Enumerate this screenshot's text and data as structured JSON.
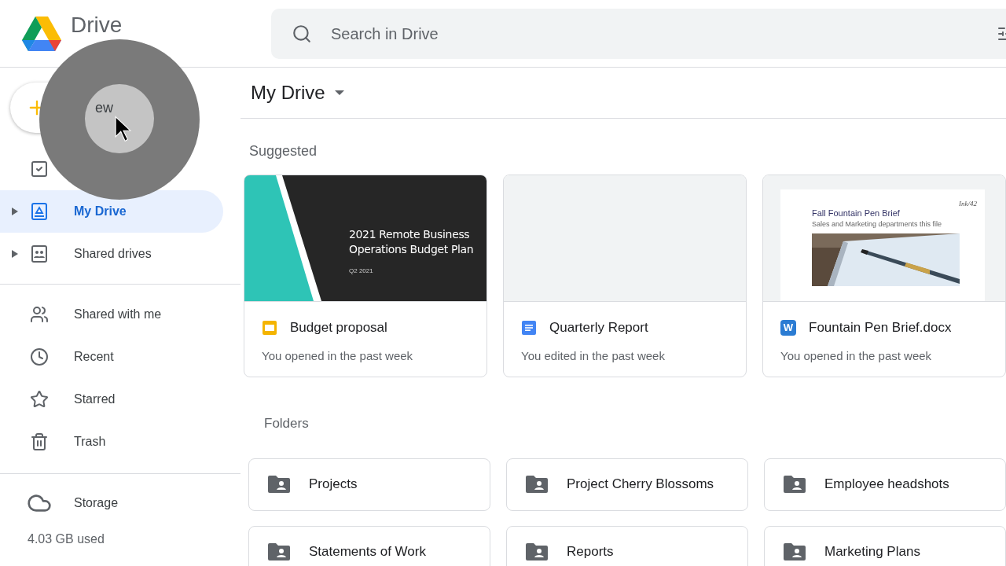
{
  "app": {
    "name": "Drive"
  },
  "search": {
    "placeholder": "Search in Drive"
  },
  "new_button": {
    "label": "ew"
  },
  "sidebar": {
    "items": [
      {
        "selected": false,
        "expandable": false
      },
      {
        "label": "My Drive",
        "selected": true,
        "expandable": true
      },
      {
        "label": "Shared drives",
        "selected": false,
        "expandable": true
      },
      {
        "label": "Shared with me",
        "selected": false,
        "expandable": false
      },
      {
        "label": "Recent",
        "selected": false,
        "expandable": false
      },
      {
        "label": "Starred",
        "selected": false,
        "expandable": false
      },
      {
        "label": "Trash",
        "selected": false,
        "expandable": false
      }
    ],
    "storage": {
      "label": "Storage",
      "usage": "4.03 GB used"
    }
  },
  "header": {
    "title": "My Drive"
  },
  "suggested": {
    "title": "Suggested",
    "files": [
      {
        "kind": "slides",
        "name": "Budget proposal",
        "activity": "You opened in the past week",
        "preview": {
          "title": "2021 Remote Business Operations Budget Plan",
          "subtitle": "Q2 2021"
        }
      },
      {
        "kind": "docs",
        "name": "Quarterly Report",
        "activity": "You edited in the past week"
      },
      {
        "kind": "word",
        "name": "Fountain Pen Brief.docx",
        "icon_letter": "W",
        "activity": "You opened in the past week",
        "preview": {
          "brand": "Ink/42",
          "title": "Fall Fountain Pen Brief",
          "subtitle": "Sales and Marketing departments this file"
        }
      }
    ]
  },
  "folders": {
    "title": "Folders",
    "items": [
      "Projects",
      "Project Cherry Blossoms",
      "Employee headshots",
      "Statements of Work",
      "Reports",
      "Marketing Plans"
    ]
  }
}
